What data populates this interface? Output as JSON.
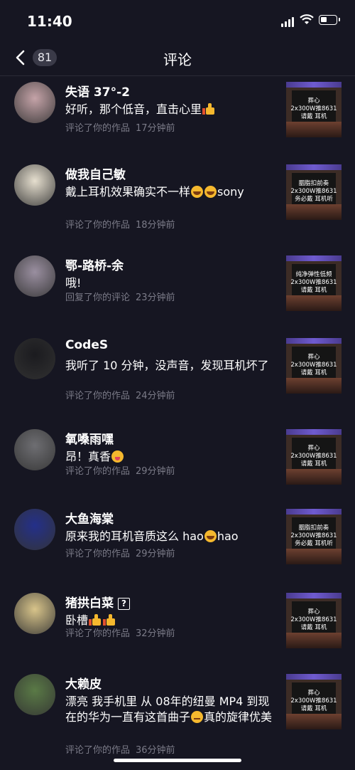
{
  "status": {
    "time": "11:40"
  },
  "header": {
    "title": "评论",
    "count": "81"
  },
  "comments": [
    {
      "name": "失语 37°-2",
      "text": [
        "好听，那个低音，直击心里",
        {
          "emoji": "thumbs-up"
        }
      ],
      "action": "评论了你的作品",
      "time": "17分钟前",
      "avatar": "#c5a3a8",
      "thumb": {
        "lines": [
          "葬心",
          "2x300W推8631",
          "请戴  耳机"
        ]
      }
    },
    {
      "name": "做我自己敏",
      "text": [
        "戴上耳机效果确实不一样",
        {
          "emoji": "laugh"
        },
        {
          "emoji": "laugh"
        },
        "sony"
      ],
      "action": "评论了你的作品",
      "time": "18分钟前",
      "avatar": "#e6dfcf",
      "thumb": {
        "lines": [
          "胭脂扣前奏",
          "2x300W推8631",
          "务必戴 耳机听"
        ]
      }
    },
    {
      "name": "鄂-路桥-余",
      "text": [
        "哦!"
      ],
      "action": "回复了你的评论",
      "time": "23分钟前",
      "avatar": "#9a8fa0",
      "thumb": {
        "lines": [
          "纯净弹性低频",
          "2x300W推8631",
          "请戴  耳机"
        ]
      }
    },
    {
      "name": "CodeS",
      "text": [
        "我听了 10 分钟，没声音，发现耳机坏了"
      ],
      "action": "评论了你的作品",
      "time": "24分钟前",
      "avatar": "#1b1b1f",
      "thumb": {
        "lines": [
          "葬心",
          "2x300W推8631",
          "请戴  耳机"
        ]
      }
    },
    {
      "name": "氧嗓雨嘿",
      "text": [
        "昂！真香",
        {
          "emoji": "savor"
        }
      ],
      "action": "评论了你的作品",
      "time": "29分钟前",
      "avatar": "#6e6e72",
      "thumb": {
        "lines": [
          "葬心",
          "2x300W推8631",
          "请戴  耳机"
        ]
      }
    },
    {
      "name": "大鱼海棠",
      "text": [
        "原来我的耳机音质这么 hao",
        {
          "emoji": "laugh"
        },
        "hao"
      ],
      "action": "评论了你的作品",
      "time": "29分钟前",
      "avatar": "#24308a",
      "thumb": {
        "lines": [
          "胭脂扣前奏",
          "2x300W推8631",
          "务必戴 耳机听"
        ]
      }
    },
    {
      "name": "猪拱白菜",
      "text": [
        "卧槽",
        {
          "emoji": "thumbs-up"
        },
        {
          "emoji": "thumbs-up"
        }
      ],
      "action": "评论了你的作品",
      "time": "32分钟前",
      "avatar": "#d8c48a",
      "badge": "?",
      "thumb": {
        "lines": [
          "葬心",
          "2x300W推8631",
          "请戴  耳机"
        ]
      }
    },
    {
      "name": "大赖皮",
      "text": [
        "漂亮 我手机里 从 08年的纽曼 MP4 到现在的华为一直有这首曲子",
        {
          "emoji": "think"
        },
        "真的旋律优美"
      ],
      "action": "评论了你的作品",
      "time": "36分钟前",
      "avatar": "#5a7a46",
      "thumb": {
        "lines": [
          "葬心",
          "2x300W推8631",
          "请戴  耳机"
        ]
      }
    }
  ]
}
